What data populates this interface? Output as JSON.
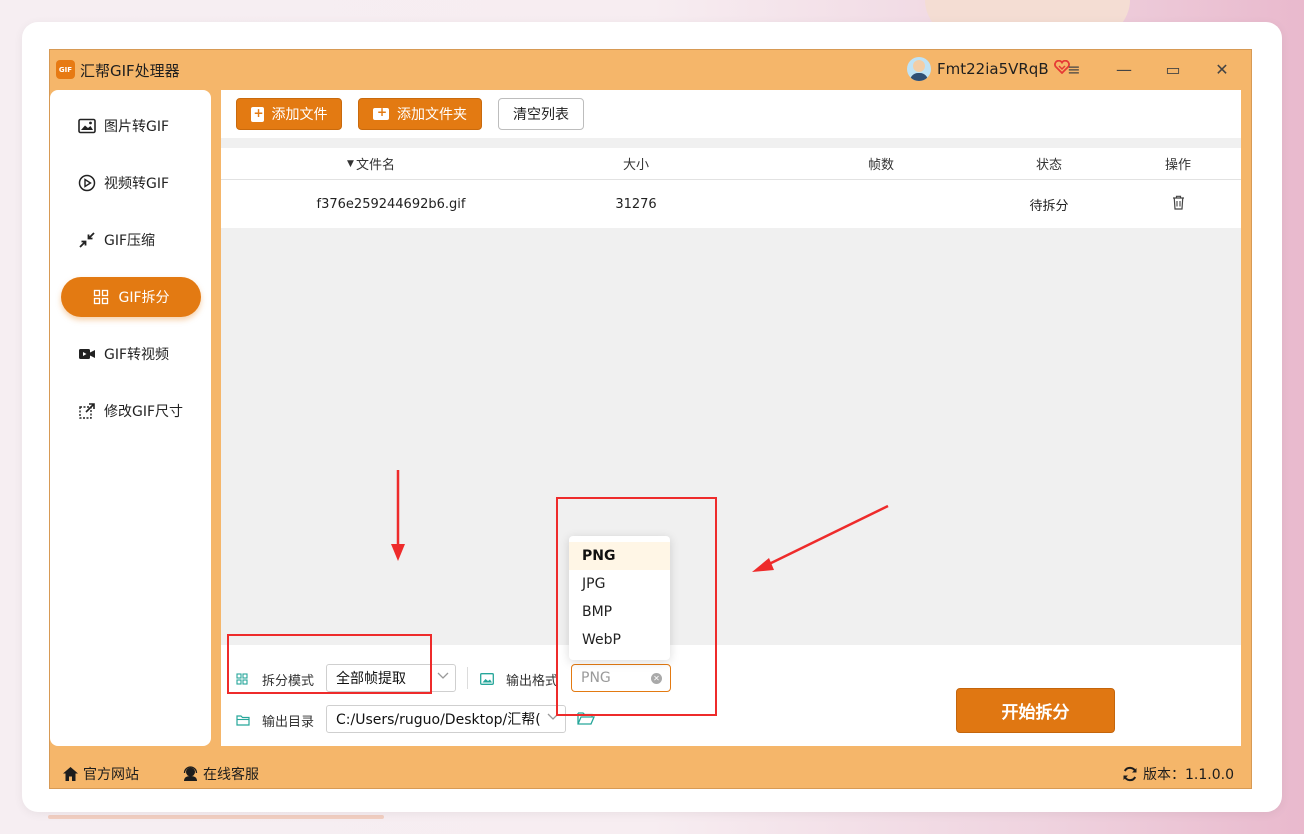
{
  "app": {
    "logo_text": "GIF",
    "title": "汇帮GIF处理器",
    "username": "Fmt22ia5VRqB",
    "menu_glyph": "≡",
    "minimize_glyph": "—",
    "maximize_glyph": "▭",
    "close_glyph": "✕"
  },
  "sidebar": {
    "items": [
      {
        "label": "图片转GIF",
        "icon": "image-icon"
      },
      {
        "label": "视频转GIF",
        "icon": "play-circle-icon"
      },
      {
        "label": "GIF压缩",
        "icon": "compress-arrows-icon"
      },
      {
        "label": "GIF拆分",
        "icon": "grid-split-icon",
        "active": true
      },
      {
        "label": "GIF转视频",
        "icon": "video-camera-icon"
      },
      {
        "label": "修改GIF尺寸",
        "icon": "resize-icon"
      }
    ]
  },
  "toolbar": {
    "add_file": "添加文件",
    "add_folder": "添加文件夹",
    "clear_list": "清空列表"
  },
  "table": {
    "sort_indicator": "▼",
    "columns": [
      "文件名",
      "大小",
      "帧数",
      "状态",
      "操作"
    ],
    "rows": [
      {
        "filename": "f376e259244692b6.gif",
        "size": "31276",
        "frames": "",
        "status": "待拆分"
      }
    ]
  },
  "settings": {
    "split_mode_label": "拆分模式",
    "split_mode_value": "全部帧提取",
    "output_format_label": "输出格式",
    "output_format_value": "PNG",
    "output_dir_label": "输出目录",
    "output_dir_value": "C:/Users/ruguo/Desktop/汇帮(",
    "format_options": [
      "PNG",
      "JPG",
      "BMP",
      "WebP"
    ],
    "selected_format": "PNG"
  },
  "actions": {
    "start": "开始拆分"
  },
  "footer": {
    "website": "官方网站",
    "support": "在线客服",
    "version": "版本：1.1.0.0"
  },
  "colors": {
    "accent": "#e37a12",
    "frame": "#f5b66a",
    "annotation": "#ee2b2b"
  }
}
